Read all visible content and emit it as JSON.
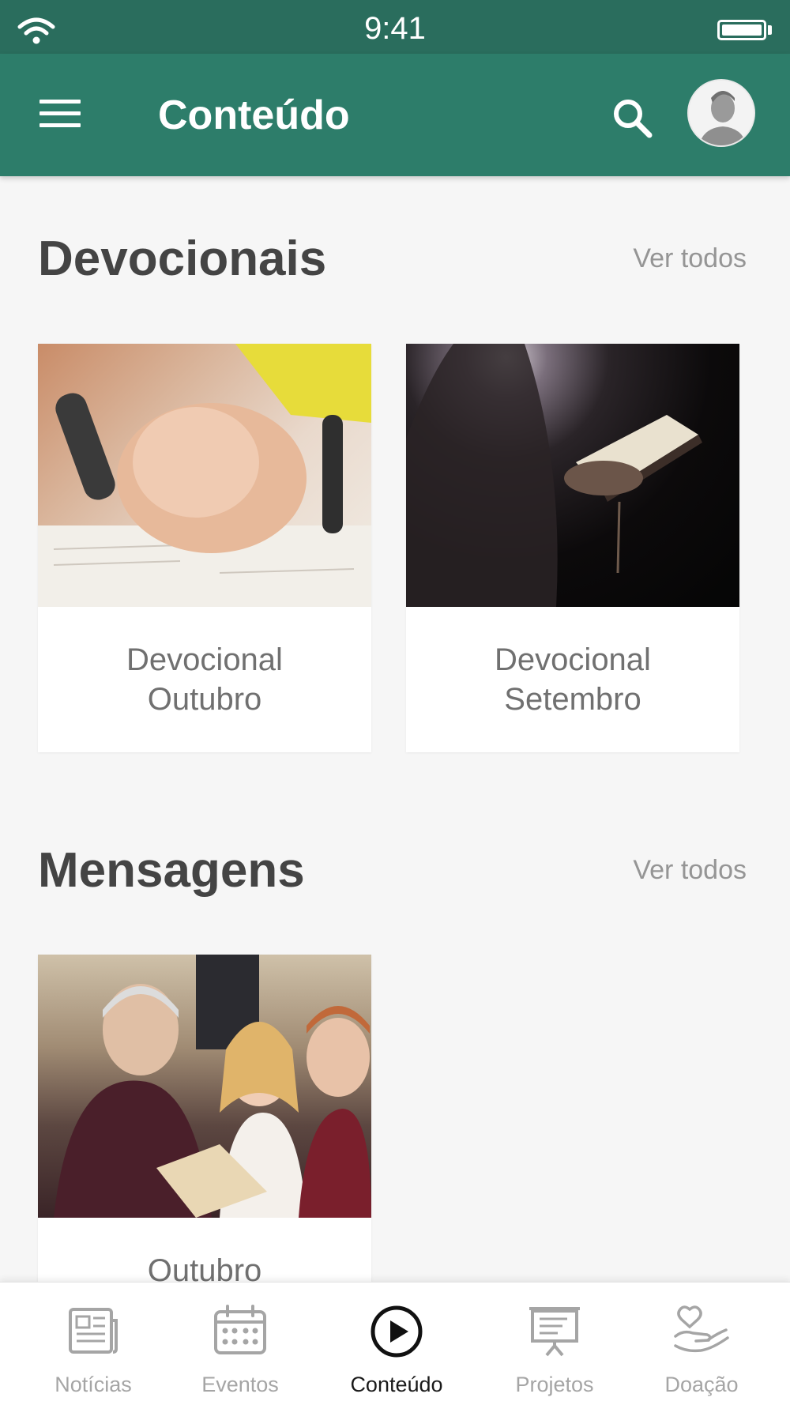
{
  "status_bar": {
    "time": "9:41"
  },
  "header": {
    "title": "Conteúdo"
  },
  "sections": [
    {
      "title": "Devocionais",
      "see_all": "Ver todos",
      "cards": [
        {
          "caption": "Devocional Outubro"
        },
        {
          "caption": "Devocional Setembro"
        }
      ]
    },
    {
      "title": "Mensagens",
      "see_all": "Ver todos",
      "cards": [
        {
          "caption": "Outubro"
        }
      ]
    }
  ],
  "bottom_nav": {
    "items": [
      {
        "label": "Notícias",
        "icon": "newspaper-icon"
      },
      {
        "label": "Eventos",
        "icon": "calendar-icon"
      },
      {
        "label": "Conteúdo",
        "icon": "play-circle-icon",
        "active": true
      },
      {
        "label": "Projetos",
        "icon": "presentation-icon"
      },
      {
        "label": "Doação",
        "icon": "heart-hand-icon"
      }
    ]
  },
  "colors": {
    "status_bar": "#2a6d5d",
    "app_bar": "#2d7d6a",
    "background": "#f6f6f6",
    "active_tab": "#1a1a1a",
    "inactive_tab": "#a5a5a5"
  }
}
